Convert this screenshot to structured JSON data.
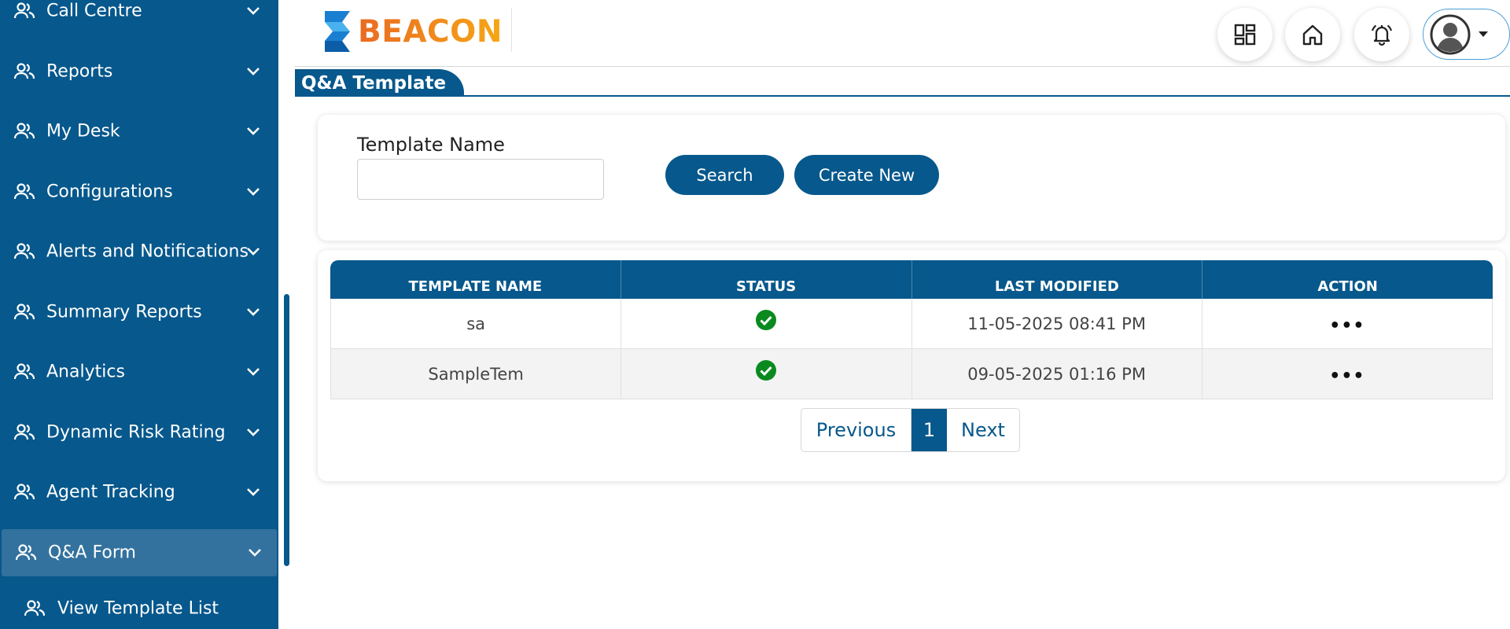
{
  "sidebar": {
    "items": [
      {
        "label": "Call Centre"
      },
      {
        "label": "Reports"
      },
      {
        "label": "My Desk"
      },
      {
        "label": "Configurations"
      },
      {
        "label": "Alerts and Notifications"
      },
      {
        "label": "Summary Reports"
      },
      {
        "label": "Analytics"
      },
      {
        "label": "Dynamic Risk Rating"
      },
      {
        "label": "Agent Tracking"
      },
      {
        "label": "Q&A Form"
      }
    ],
    "active_item": "Q&A Form",
    "sub_item": {
      "label": "View Template List"
    }
  },
  "header": {
    "logo_text": "BEACON",
    "buttons": [
      "dashboard-icon",
      "home-icon",
      "bell-icon",
      "user-avatar-icon"
    ]
  },
  "page": {
    "title": "Q&A Template"
  },
  "search": {
    "field_label": "Template Name",
    "field_value": "",
    "search_label": "Search",
    "create_label": "Create New"
  },
  "table": {
    "columns": [
      "TEMPLATE NAME",
      "STATUS",
      "LAST MODIFIED",
      "ACTION"
    ],
    "rows": [
      {
        "name": "sa",
        "status": "active",
        "last_modified": "11-05-2025 08:41 PM",
        "action": "•••"
      },
      {
        "name": "SampleTem",
        "status": "active",
        "last_modified": "09-05-2025 01:16 PM",
        "action": "•••"
      }
    ]
  },
  "pagination": {
    "previous_label": "Previous",
    "current_page": "1",
    "next_label": "Next"
  },
  "colors": {
    "primary": "#07588c",
    "active_nav": "#33729e",
    "status_ok": "#0a8a1e",
    "logo_orange": "#ea6a22"
  }
}
